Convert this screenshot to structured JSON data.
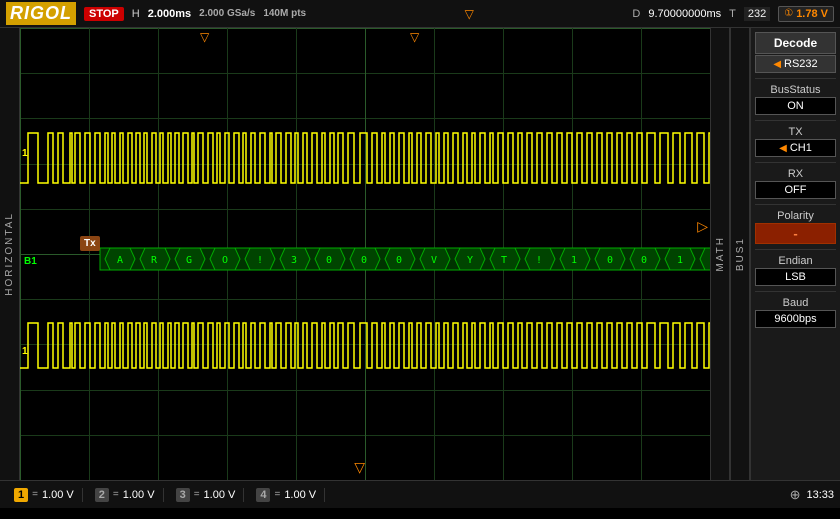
{
  "topbar": {
    "logo": "RIGOL",
    "stop_label": "STOP",
    "h_label": "H",
    "h_value": "2.000ms",
    "sample_rate": "2.000 GSa/s",
    "memory": "140M pts",
    "d_label": "D",
    "d_value": "9.70000000ms",
    "t_label": "T",
    "trig_count": "232",
    "trig_level_icon": "①",
    "trig_voltage": "1.78 V"
  },
  "leftlabel": {
    "text": "HORIZONTAL"
  },
  "scope": {
    "trigger_orange_char": "▽",
    "trigger_center_char": "▽",
    "arrow_right_char": "▷",
    "arrow_down_char": "▽",
    "tx_label": "Tx",
    "bus_label": "B1"
  },
  "math_label": "MATH",
  "bus1_label": "BUS1",
  "sidebar": {
    "decode_label": "Decode",
    "decode_value": "RS232",
    "busstatus_label": "BusStatus",
    "busstatus_value": "ON",
    "tx_label": "TX",
    "tx_value": "CH1",
    "rx_label": "RX",
    "rx_value": "OFF",
    "polarity_label": "Polarity",
    "polarity_value": "-",
    "endian_label": "Endian",
    "endian_value": "LSB",
    "baud_label": "Baud",
    "baud_value": "9600bps"
  },
  "bottombar": {
    "ch1_num": "1",
    "ch1_coupling": "=",
    "ch1_volt": "1.00 V",
    "ch2_num": "2",
    "ch2_coupling": "=",
    "ch2_volt": "1.00 V",
    "ch3_num": "3",
    "ch3_coupling": "=",
    "ch3_volt": "1.00 V",
    "ch4_num": "4",
    "ch4_coupling": "=",
    "ch4_volt": "1.00 V",
    "usb_icon": "⊕",
    "time": "13:33"
  },
  "waveform": {
    "ch1_color": "#ffff00",
    "ch2_color": "#ffff00",
    "bus_color": "#00cc00",
    "decode_color": "#00cc00"
  }
}
